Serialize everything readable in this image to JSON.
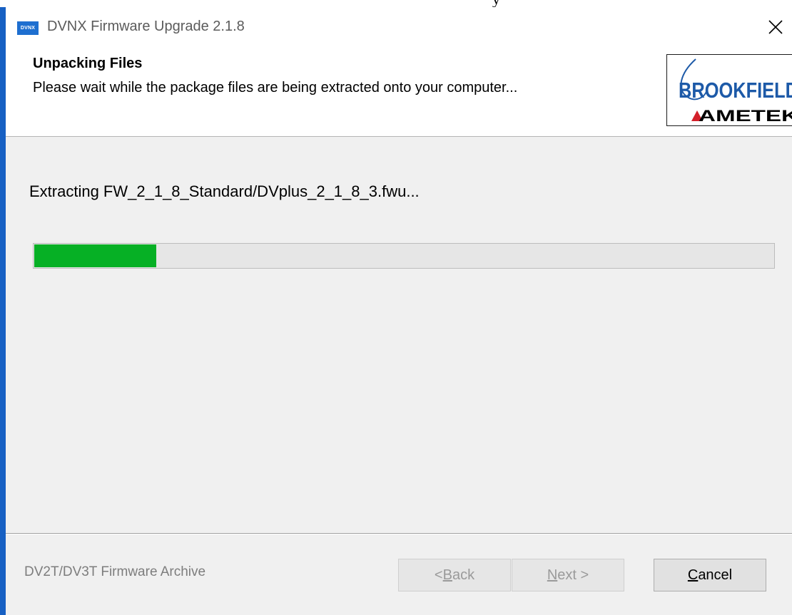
{
  "cropped_text_fragment": "y",
  "window": {
    "title": "DVNX Firmware Upgrade 2.1.8",
    "app_icon_text": "DVNX",
    "close_glyph": "✕"
  },
  "header": {
    "title": "Unpacking Files",
    "subtitle": "Please wait while the package files are being extracted onto your computer...",
    "logo": {
      "line1": "BROOKFIELD",
      "line2": "AMETEK"
    }
  },
  "content": {
    "status_text": "Extracting FW_2_1_8_Standard/DVplus_2_1_8_3.fwu...",
    "progress_fraction": 0.165
  },
  "footer": {
    "label": "DV2T/DV3T Firmware Archive",
    "buttons": {
      "back": {
        "prefix": "< ",
        "accel": "B",
        "rest": "ack",
        "enabled": false
      },
      "next": {
        "prefix": "",
        "accel": "N",
        "rest": "ext >",
        "enabled": false
      },
      "cancel": {
        "prefix": "",
        "accel": "C",
        "rest": "ancel",
        "enabled": true
      }
    }
  },
  "colors": {
    "window_border": "#1760c3",
    "progress_fill": "#06b025",
    "logo_blue": "#1d5aa8",
    "logo_red": "#d3202a"
  }
}
